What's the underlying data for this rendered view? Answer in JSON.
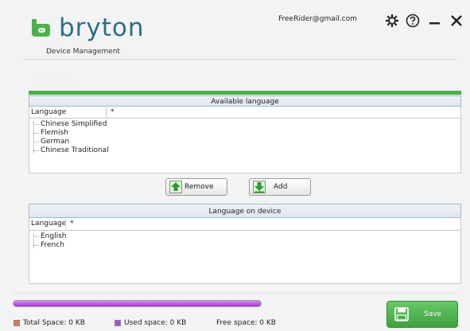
{
  "header": {
    "brand": "bryton",
    "subtitle": "Device Management",
    "account_email": "FreeRider@gmail.com",
    "icons": [
      "gear-icon",
      "help-icon",
      "minimize-icon",
      "close-icon"
    ]
  },
  "section_title": "Language",
  "available": {
    "title": "Available language",
    "col_language": "Language",
    "col_star": "*",
    "items": [
      "Chinese Simplified",
      "Flemish",
      "German",
      "Chinese Traditional"
    ]
  },
  "buttons": {
    "remove": "Remove",
    "add": "Add"
  },
  "on_device": {
    "title": "Language on device",
    "col_language": "Language",
    "col_star": "*",
    "items": [
      "English",
      "French"
    ]
  },
  "storage": {
    "progress_fraction": 1.0,
    "total": "Total Space: 0 KB",
    "used": "Used space: 0 KB",
    "free": "Free space: 0 KB"
  },
  "save_label": "Save",
  "colors": {
    "accent_green": "#49b048",
    "brand_blue": "#2a6f87",
    "total_legend": "#e07a4b",
    "used_legend": "#a64fd8",
    "progress": "#b23fe0"
  }
}
